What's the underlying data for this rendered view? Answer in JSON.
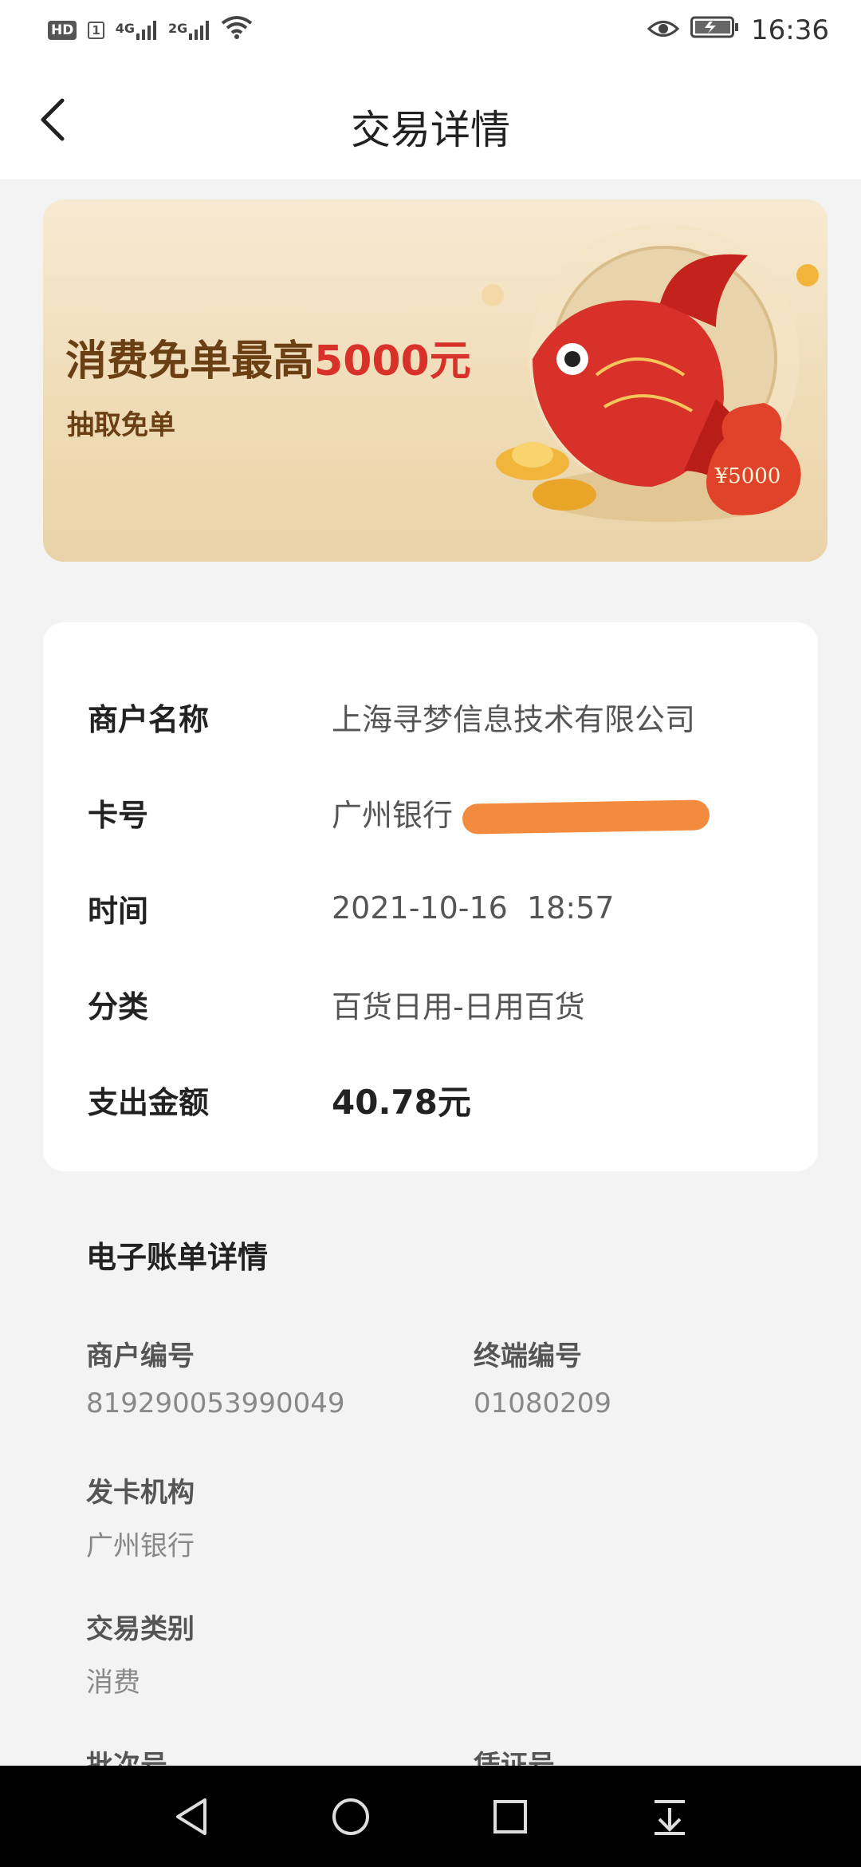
{
  "status_bar": {
    "hd": "HD",
    "sim1": "1",
    "net1": "4G",
    "net2": "2G",
    "time": "16:36"
  },
  "header": {
    "title": "交易详情"
  },
  "banner": {
    "title_main": "消费免单最高",
    "title_highlight": "5000元",
    "subtitle": "抽取免单",
    "bag_text": "¥5000"
  },
  "details": [
    {
      "label": "商户名称",
      "value": "上海寻梦信息技术有限公司"
    },
    {
      "label": "卡号",
      "value": "广州银行"
    },
    {
      "label": "时间",
      "value": "2021-10-16  18:57"
    },
    {
      "label": "分类",
      "value": "百货日用-日用百货"
    },
    {
      "label": "支出金额",
      "value": "40.78元"
    }
  ],
  "ebill": {
    "title": "电子账单详情",
    "fields": [
      {
        "label": "商户编号",
        "value": "819290053990049"
      },
      {
        "label": "终端编号",
        "value": "01080209"
      },
      {
        "label": "发卡机构",
        "value": "广州银行"
      },
      {
        "label": "交易类别",
        "value": "消费"
      },
      {
        "label": "批次号",
        "value": ""
      },
      {
        "label": "凭证号",
        "value": ""
      }
    ]
  },
  "colors": {
    "accent_red": "#d7312a",
    "banner_text": "#6b3f14",
    "redaction": "#f28b3d"
  }
}
